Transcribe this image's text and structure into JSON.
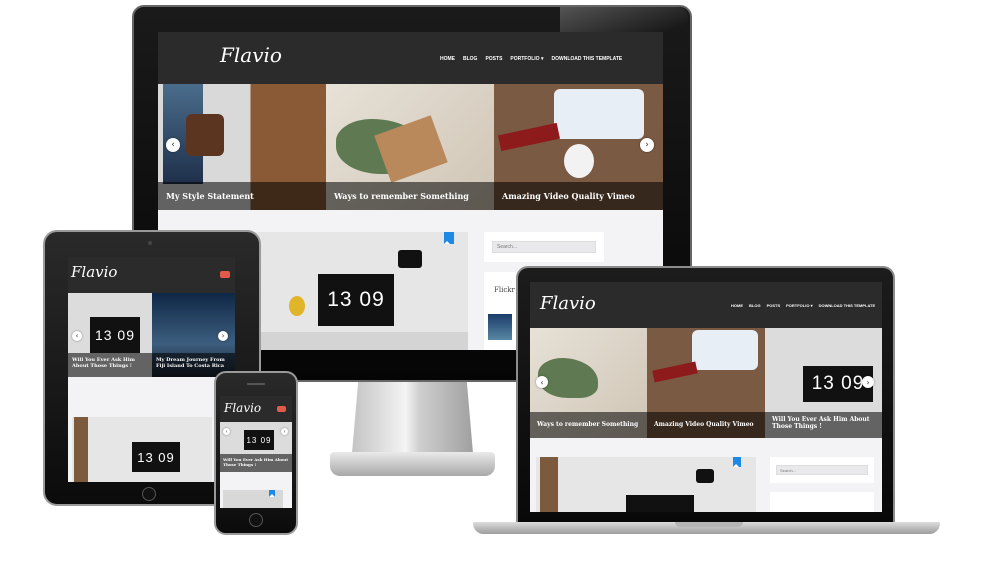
{
  "site": {
    "logo": "Flavio",
    "nav": [
      "HOME",
      "BLOG",
      "POSTS",
      "PORTFOLIO ▾",
      "DOWNLOAD THIS TEMPLATE"
    ],
    "search_placeholder": "Search..."
  },
  "monitor": {
    "slides": [
      "My Style Statement",
      "Ways to remember Something",
      "Amazing Video Quality Vimeo"
    ],
    "clock": "13 09",
    "sidebar_title": "Flickr"
  },
  "tablet": {
    "slides": [
      "Will You Ever Ask Him About Those Things !",
      "My Dream Journey From Fiji Island To Costa Rica"
    ],
    "clock": "13 09"
  },
  "phone": {
    "slide": "Will You Ever Ask Him About Those Things !"
  },
  "laptop": {
    "slides": [
      "Ways to remember Something",
      "Amazing Video Quality Vimeo",
      "Will You Ever Ask Him About Those Things !"
    ],
    "clock": "13 09"
  },
  "colors": {
    "header": "#2b2b2b",
    "accent_blue": "#1e88e5",
    "menu_red": "#e25a4a"
  }
}
